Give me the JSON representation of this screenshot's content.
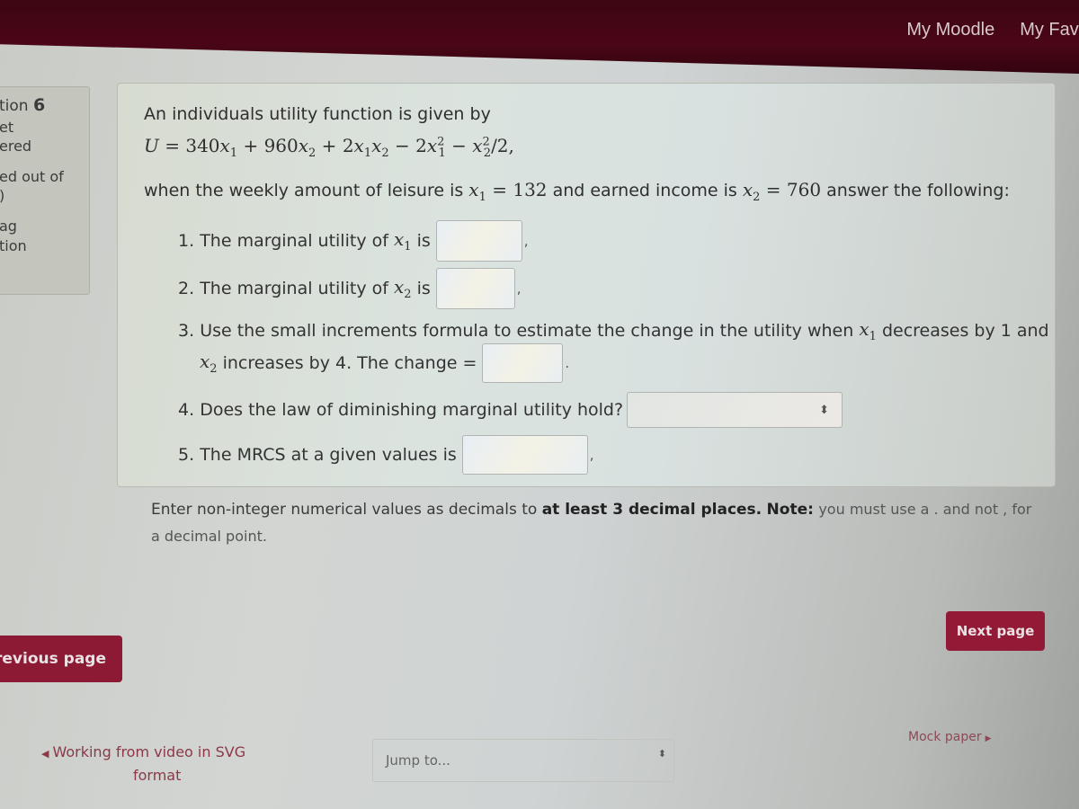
{
  "navbar": {
    "links": [
      "My Moodle",
      "My Favou"
    ],
    "color": "#3d0512"
  },
  "qinfo": {
    "question_prefix": "tion",
    "question_number": "6",
    "status_line1": "et",
    "status_line2": "ered",
    "marked_line1": "ed out of",
    "marked_line2": ")",
    "flag_line1": "ag",
    "flag_line2": "tion"
  },
  "question": {
    "intro": "An individuals utility function is given by",
    "formula": {
      "lhs": "U",
      "c1": "340",
      "c2": "960",
      "c3": "2",
      "c4": "2",
      "tail": "/2,"
    },
    "condition": {
      "before": "when the weekly amount of leisure is",
      "x1_value": "132",
      "middle": "and earned income is",
      "x2_value": "760",
      "after": "answer the following:"
    },
    "items": [
      {
        "number": "1.",
        "text": "The marginal utility of",
        "var": "x",
        "sub": "1",
        "suffix": "is",
        "answer": "",
        "trail": ","
      },
      {
        "number": "2.",
        "text": "The marginal utility of",
        "var": "x",
        "sub": "2",
        "suffix": "is",
        "answer": "",
        "trail": ","
      },
      {
        "number": "3.",
        "text_a": "Use the small increments formula to estimate the change in the utility when",
        "var_a": "x",
        "sub_a": "1",
        "text_b": "decreases by 1 and",
        "var_b": "x",
        "sub_b": "2",
        "text_c": "increases by 4. The change =",
        "answer": "",
        "trail": "."
      },
      {
        "number": "4.",
        "text": "Does the law of diminishing marginal utility hold?",
        "selected": "",
        "updown_icon": "updown-arrows-icon"
      },
      {
        "number": "5.",
        "text": "The MRCS at a given values is",
        "answer": "",
        "trail": ","
      }
    ],
    "note": {
      "a": "Enter non-integer numerical values as decimals to",
      "b": "at least 3 decimal places.",
      "c": "Note:",
      "d": "you must use a . and not , for a decimal point."
    }
  },
  "navigation": {
    "previous_label": "revious page",
    "next_label": "Next page",
    "accent_color": "#8d1a35"
  },
  "activity_nav": {
    "previous_activity_line1": "Working from video in SVG",
    "previous_activity_line2": "format",
    "jump_placeholder": "Jump to...",
    "next_activity": "Mock paper"
  }
}
